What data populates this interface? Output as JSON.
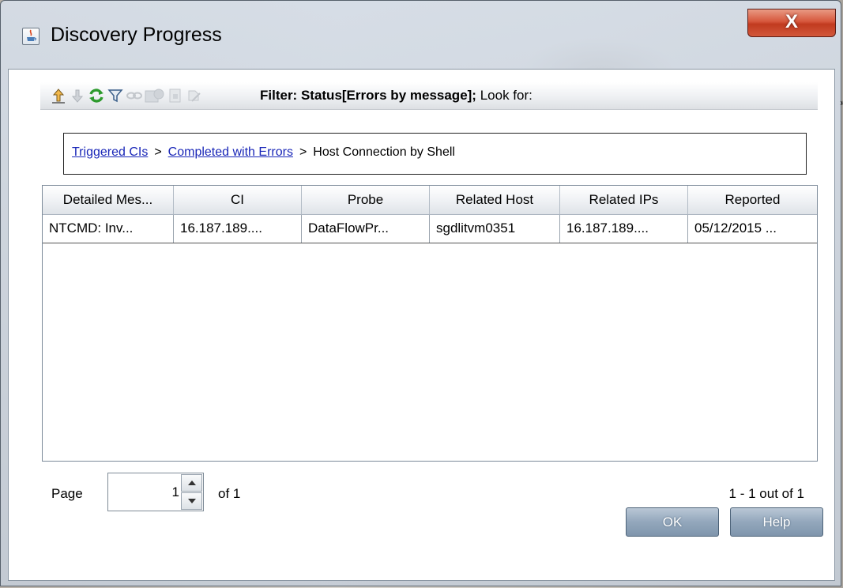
{
  "window": {
    "title": "Discovery Progress",
    "close_label": "X"
  },
  "toolbar": {
    "icons": [
      "move-up-icon",
      "move-down-icon",
      "refresh-icon",
      "filter-icon",
      "link-icon",
      "report-icon",
      "export-icon",
      "edit-icon"
    ],
    "filter_prefix": "Filter: Status[Errors by message];",
    "look_for_label": "Look for:",
    "more_label": "»"
  },
  "breadcrumb": {
    "items": [
      {
        "label": "Triggered CIs",
        "link": true
      },
      {
        "label": "Completed with Errors",
        "link": true
      },
      {
        "label": "Host Connection by Shell",
        "link": false
      }
    ],
    "separator": ">"
  },
  "table": {
    "columns": [
      "Detailed Mes...",
      "CI",
      "Probe",
      "Related Host",
      "Related IPs",
      "Reported"
    ],
    "rows": [
      [
        "NTCMD: Inv...",
        "16.187.189....",
        "DataFlowPr...",
        "sgdlitvm0351",
        "16.187.189....",
        "05/12/2015 ..."
      ]
    ]
  },
  "pagination": {
    "page_label": "Page",
    "page_value": "1",
    "of_label": "of 1",
    "range_label": "1 - 1 out of 1"
  },
  "buttons": {
    "ok_label": "OK",
    "help_label": "Help"
  },
  "colors": {
    "link": "#1a27b8",
    "refresh_icon": "#2e9b2e",
    "close_button": "#c94a2e",
    "button_face": "#93a7bc"
  }
}
